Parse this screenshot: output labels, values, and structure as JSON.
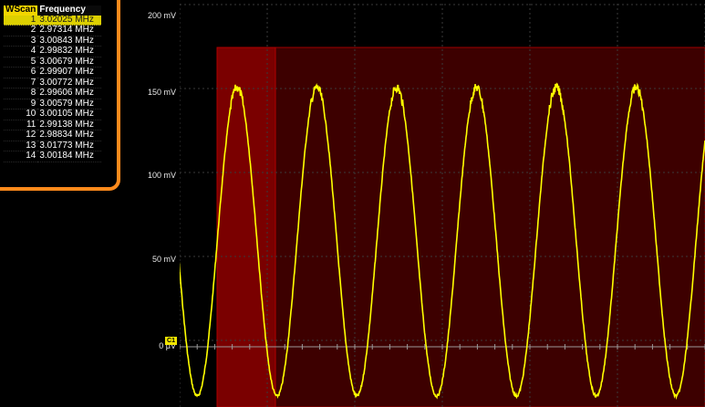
{
  "scan_table": {
    "headers": {
      "index": "WScan",
      "value": "Frequency"
    },
    "selected_index": 0,
    "rows": [
      {
        "idx": "1",
        "freq": "3.02025 MHz"
      },
      {
        "idx": "2",
        "freq": "2.97314 MHz"
      },
      {
        "idx": "3",
        "freq": "3.00843 MHz"
      },
      {
        "idx": "4",
        "freq": "2.99832 MHz"
      },
      {
        "idx": "5",
        "freq": "3.00679 MHz"
      },
      {
        "idx": "6",
        "freq": "2.99907 MHz"
      },
      {
        "idx": "7",
        "freq": "3.00772 MHz"
      },
      {
        "idx": "8",
        "freq": "2.99606 MHz"
      },
      {
        "idx": "9",
        "freq": "3.00579 MHz"
      },
      {
        "idx": "10",
        "freq": "3.00105 MHz"
      },
      {
        "idx": "11",
        "freq": "2.99138 MHz"
      },
      {
        "idx": "12",
        "freq": "2.98834 MHz"
      },
      {
        "idx": "13",
        "freq": "3.01773 MHz"
      },
      {
        "idx": "14",
        "freq": "3.00184 MHz"
      }
    ]
  },
  "y_axis": {
    "labels": [
      "200 mV",
      "150 mV",
      "100 mV",
      "50 mV",
      "0 μV"
    ]
  },
  "channel_marker": "C1",
  "colors": {
    "trace": "#ffff00",
    "highlight": "#8a0000",
    "panel_border": "#ff8a1c",
    "selected_row": "#ddd000"
  }
}
